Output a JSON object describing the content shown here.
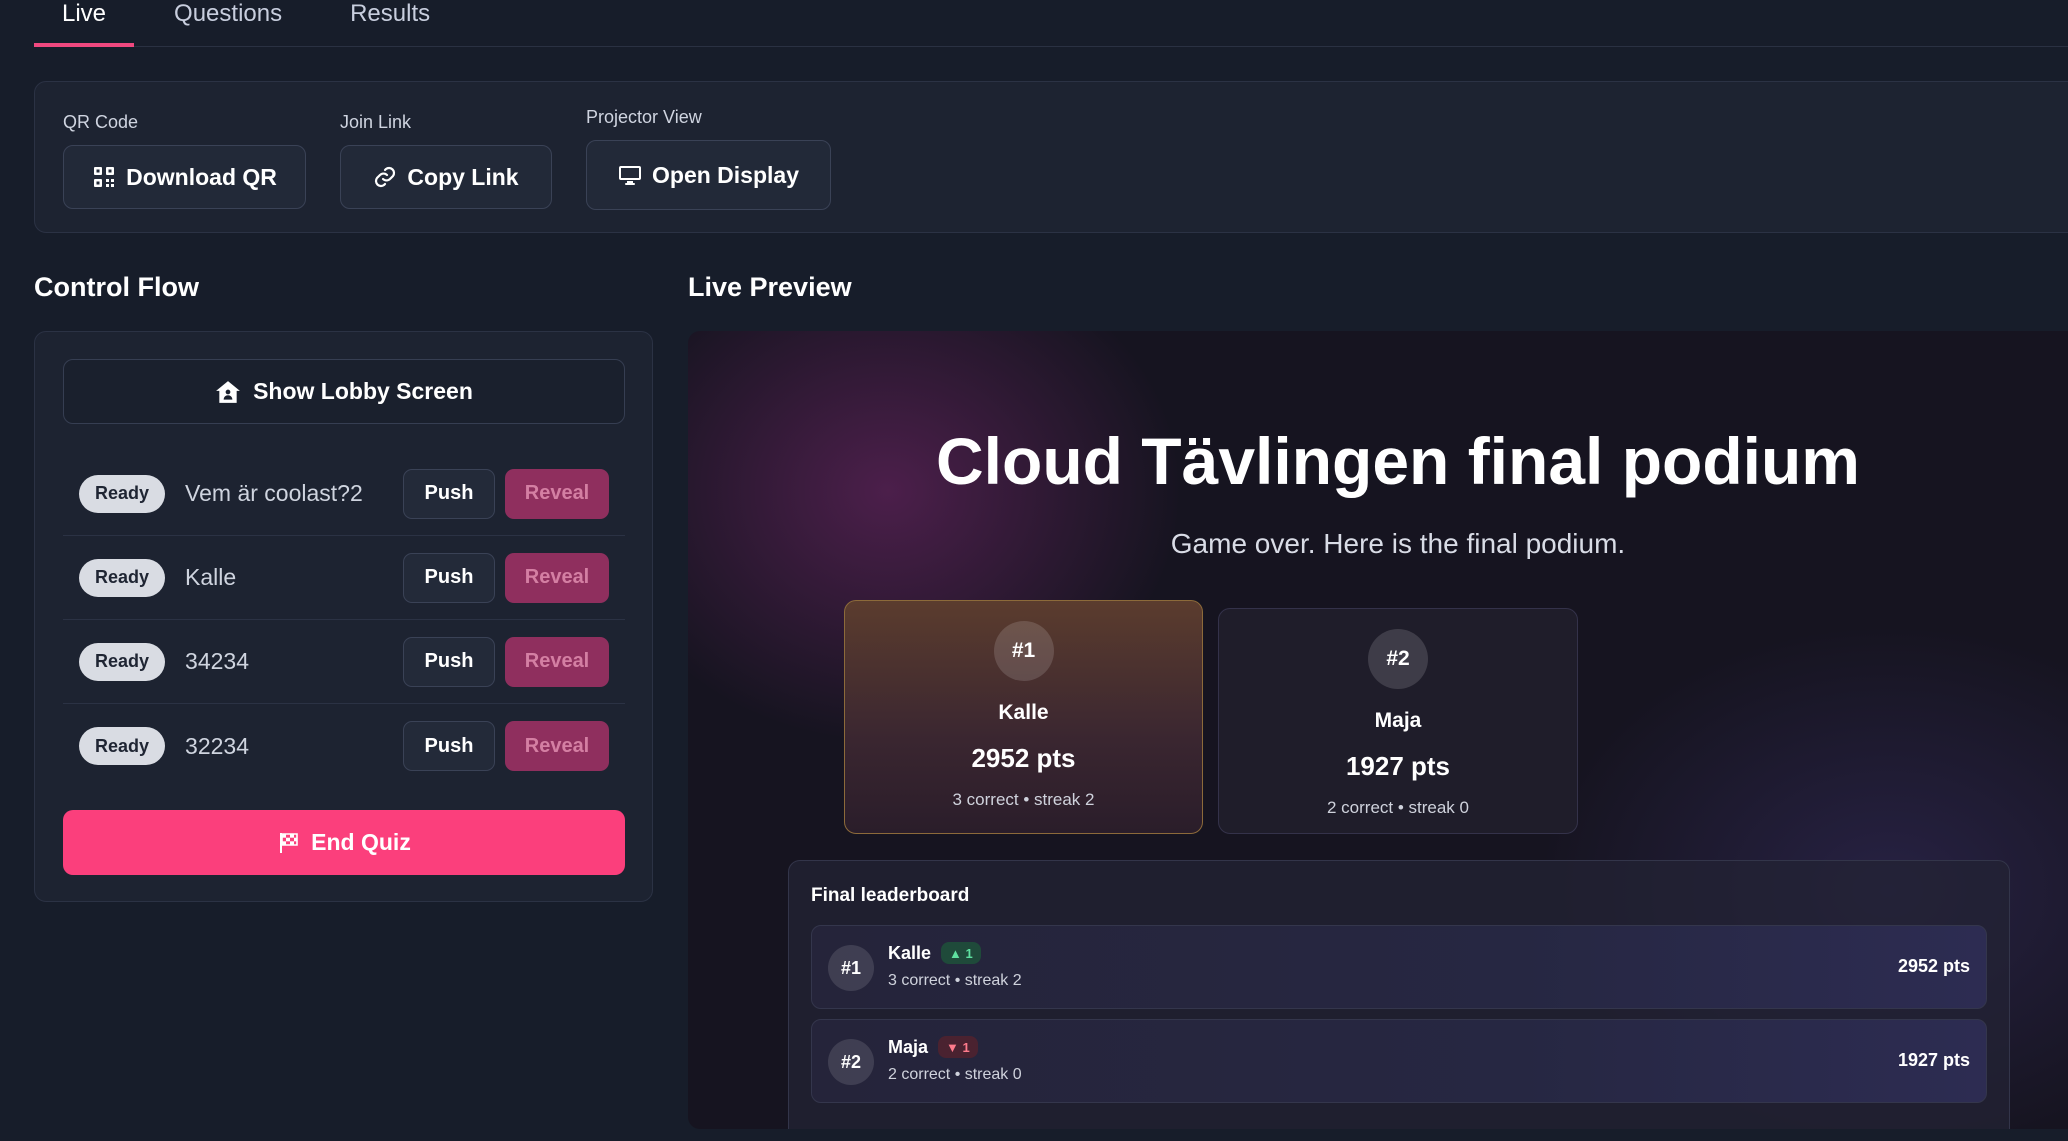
{
  "tabs": [
    {
      "label": "Live"
    },
    {
      "label": "Questions"
    },
    {
      "label": "Results"
    }
  ],
  "share": {
    "qr": {
      "label": "QR Code",
      "button": "Download QR"
    },
    "join": {
      "label": "Join Link",
      "button": "Copy Link"
    },
    "projector": {
      "label": "Projector View",
      "button": "Open Display"
    }
  },
  "control_flow": {
    "title": "Control Flow",
    "lobby_button": "Show Lobby Screen",
    "questions": [
      {
        "status": "Ready",
        "text": "Vem är coolast?2",
        "push": "Push",
        "reveal": "Reveal"
      },
      {
        "status": "Ready",
        "text": "Kalle",
        "push": "Push",
        "reveal": "Reveal"
      },
      {
        "status": "Ready",
        "text": "34234",
        "push": "Push",
        "reveal": "Reveal"
      },
      {
        "status": "Ready",
        "text": "32234",
        "push": "Push",
        "reveal": "Reveal"
      }
    ],
    "end_button": "End Quiz"
  },
  "live_preview": {
    "title": "Live Preview",
    "heading": "Cloud Tävlingen final podium",
    "subheading": "Game over. Here is the final podium.",
    "podium": [
      {
        "rank": "#1",
        "name": "Kalle",
        "points": "2952 pts",
        "stats": "3 correct • streak 2"
      },
      {
        "rank": "#2",
        "name": "Maja",
        "points": "1927 pts",
        "stats": "2 correct • streak 0"
      }
    ],
    "leaderboard": {
      "title": "Final leaderboard",
      "rows": [
        {
          "rank": "#1",
          "name": "Kalle",
          "movement": "▲ 1",
          "stats": "3 correct • streak 2",
          "points": "2952 pts"
        },
        {
          "rank": "#2",
          "name": "Maja",
          "movement": "▼ 1",
          "stats": "2 correct • streak 0",
          "points": "1927 pts"
        }
      ]
    }
  },
  "colors": {
    "accent": "#fb3f7c",
    "reveal": "#8f2f5e",
    "background": "#171d2a"
  }
}
